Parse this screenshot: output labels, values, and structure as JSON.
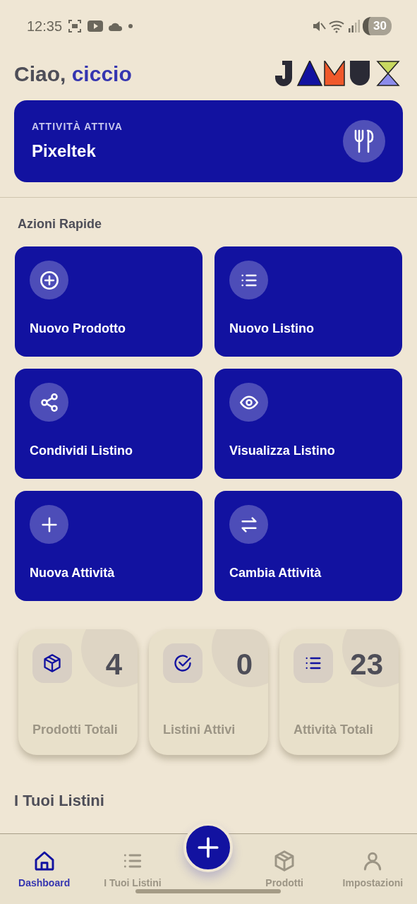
{
  "status_bar": {
    "time": "12:35",
    "battery": "30"
  },
  "header": {
    "greeting": "Ciao,",
    "user": "ciccio"
  },
  "active_business": {
    "label": "ATTIVITÀ ATTIVA",
    "name": "Pixeltek"
  },
  "quick_actions": {
    "title": "Azioni Rapide",
    "items": [
      {
        "label": "Nuovo Prodotto"
      },
      {
        "label": "Nuovo Listino"
      },
      {
        "label": "Condividi Listino"
      },
      {
        "label": "Visualizza Listino"
      },
      {
        "label": "Nuova Attività"
      },
      {
        "label": "Cambia Attività"
      }
    ]
  },
  "stats": [
    {
      "value": "4",
      "label": "Prodotti Totali"
    },
    {
      "value": "0",
      "label": "Listini Attivi"
    },
    {
      "value": "23",
      "label": "Attività Totali"
    }
  ],
  "sections": [
    {
      "title": "I Tuoi Listini"
    }
  ],
  "bottom_nav": [
    {
      "label": "Dashboard",
      "selected": true
    },
    {
      "label": "I Tuoi Listini",
      "selected": false
    },
    {
      "label": "Prodotti",
      "selected": false
    },
    {
      "label": "Impostazioni",
      "selected": false
    }
  ]
}
